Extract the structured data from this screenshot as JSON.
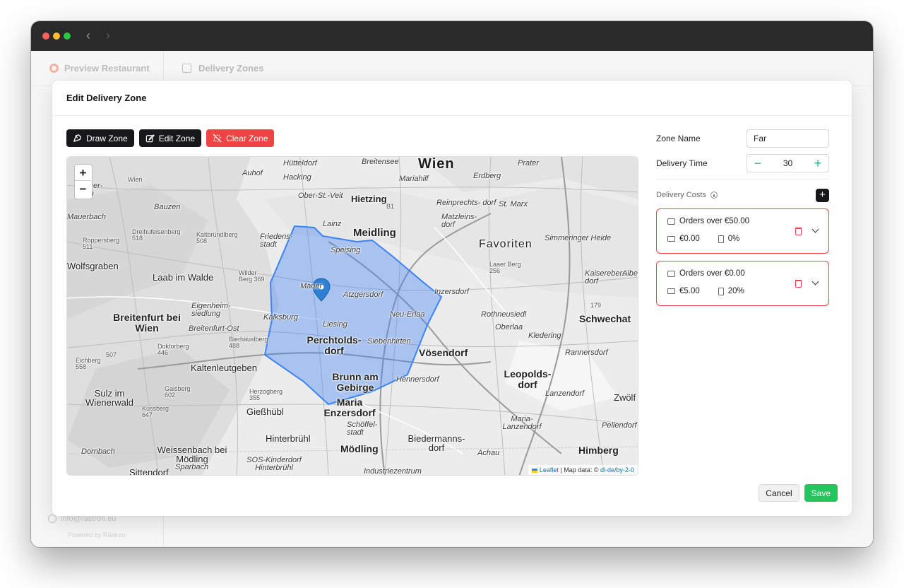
{
  "window": {
    "colors": {
      "close": "#fe5f57",
      "minimize": "#febc2e",
      "maximize": "#28c840"
    }
  },
  "nav": {
    "back": "‹",
    "forward": "›"
  },
  "header": {
    "brand": "Preview Restaurant",
    "section": "Delivery Zones"
  },
  "sidebar": {
    "user_email": "info@rastron.eu",
    "powered_by": "Powered by Rastron"
  },
  "modal": {
    "title": "Edit Delivery Zone"
  },
  "toolbar": {
    "draw_label": "Draw Zone",
    "edit_label": "Edit Zone",
    "clear_label": "Clear Zone"
  },
  "map": {
    "zoom_in": "+",
    "zoom_out": "−",
    "attribution_leaflet": "Leaflet",
    "attribution_text": "| Map data: ©",
    "attribution_license": "dl-de/by-2-0",
    "zone_color": "#3b82f6",
    "labels": {
      "wien": "Wien",
      "huetteldorf": "Hütteldorf",
      "breitensee": "Breitensee",
      "prater": "Prater",
      "auhof": "Auhof",
      "hacking": "Hacking",
      "mariahilf": "Mariahilf",
      "erdberg": "Erdberg",
      "weidlingau": "Wien",
      "obersanktveit": "Ober-St.-Veit",
      "hietzing": "Hietzing",
      "reinprechtsdorf": "Reinprechts- dorf",
      "stmarx": "St. Marx",
      "mauerbach": "Mauerbach",
      "matzleinsdorf": "Matzleins- dorf",
      "bauzen": "Bauzen",
      "lainz": "Lainz",
      "meidling": "Meidling",
      "favoriten": "Favoriten",
      "simmeringer": "Simmeringer Heide",
      "tullnerbach": "Tullner- bach",
      "roppersberg": "Roppersberg 511",
      "dreihufeisenberg": "Dreihufeisenberg 518",
      "kaltbruendlberg": "Kaltbründlberg 508",
      "friedensstadt": "Friedens- stadt",
      "speising": "Speising",
      "wolfsgraben": "Wolfsgraben",
      "laab": "Laab im Walde",
      "wilderberg": "Wilder Berg 369",
      "mauer": "Mauer",
      "atzgersdorf": "Atzgersdorf",
      "inzersdorf": "Inzersdorf",
      "laaerberg": "Laaer Berg 256",
      "kaiserebersdorf": "Kaiserebers- dorf",
      "albern": "Albern",
      "eigenheim": "Eigenheim- siedlung",
      "rothneusiedl": "Rothneusiedl",
      "breitenfurt": "Breitenfurt bei Wien",
      "kalksburg": "Kalksburg",
      "neuerlaa": "Neu-Erlaa",
      "schwechat": "Schwechat",
      "breitenfurtost": "Breitenfurt-Ost",
      "liesing": "Liesing",
      "oberlaa": "Oberlaa",
      "kledering": "Kledering",
      "hoher179": "179",
      "bierhaeuslberg": "Bierhäuslberg 488",
      "perchtoldsdorf": "Perchtolds- dorf",
      "siebenhirten": "Siebenhirten",
      "voesendorf": "Vösendorf",
      "rannersdorf": "Rannersdorf",
      "doktorberg": "Doktorberg 446",
      "eichberg": "Eichberg 558",
      "hoher507": "507",
      "kaltenleutgeben": "Kaltenleutgeben",
      "leopoldsdorf": "Leopolds- dorf",
      "brunn": "Brunn am Gebirge",
      "hennersdorf": "Hennersdorf",
      "sulz": "Sulz im Wienerwald",
      "gaisberg": "Gaisberg 602",
      "herzogberg": "Herzogberg 355",
      "lanzendorf": "Lanzendorf",
      "zwoelfaxing": "Zwölf",
      "mariaenzersdorf": "Maria Enzersdorf",
      "giesshuebl": "Gießhübl",
      "kussberg": "Kussberg 647",
      "maria_lanzendorf": "Maria- Lanzendorf",
      "pellendorf": "Pellendorf",
      "schoeffelstadt": "Schöffel- stadt",
      "hinterbruehl": "Hinterbrühl",
      "biedermannsdorf": "Biedermanns- dorf",
      "dornbach": "Dornbach",
      "weissenbach": "Weissenbach bei Mödling",
      "moedling": "Mödling",
      "achau": "Achau",
      "himberg": "Himberg",
      "sparbach": "Sparbach",
      "sos": "SOS-Kinderdorf Hinterbrühl",
      "sittendorf": "Sittendorf",
      "industriezentrum": "Industriezentrum",
      "b1": "B1"
    }
  },
  "form": {
    "zone_name_label": "Zone Name",
    "zone_name_value": "Far",
    "delivery_time_label": "Delivery Time",
    "delivery_time_value": "30",
    "minus": "−",
    "plus": "+",
    "delivery_costs_label": "Delivery Costs",
    "add": "+"
  },
  "delivery_costs": [
    {
      "condition": "Orders over €50.00",
      "fee": "€0.00",
      "percent": "0%"
    },
    {
      "condition": "Orders over €0.00",
      "fee": "€5.00",
      "percent": "20%"
    }
  ],
  "actions": {
    "cancel": "Cancel",
    "save": "Save"
  },
  "colors": {
    "danger": "#ef4444",
    "success": "#22c55e",
    "primary": "#18181b"
  }
}
